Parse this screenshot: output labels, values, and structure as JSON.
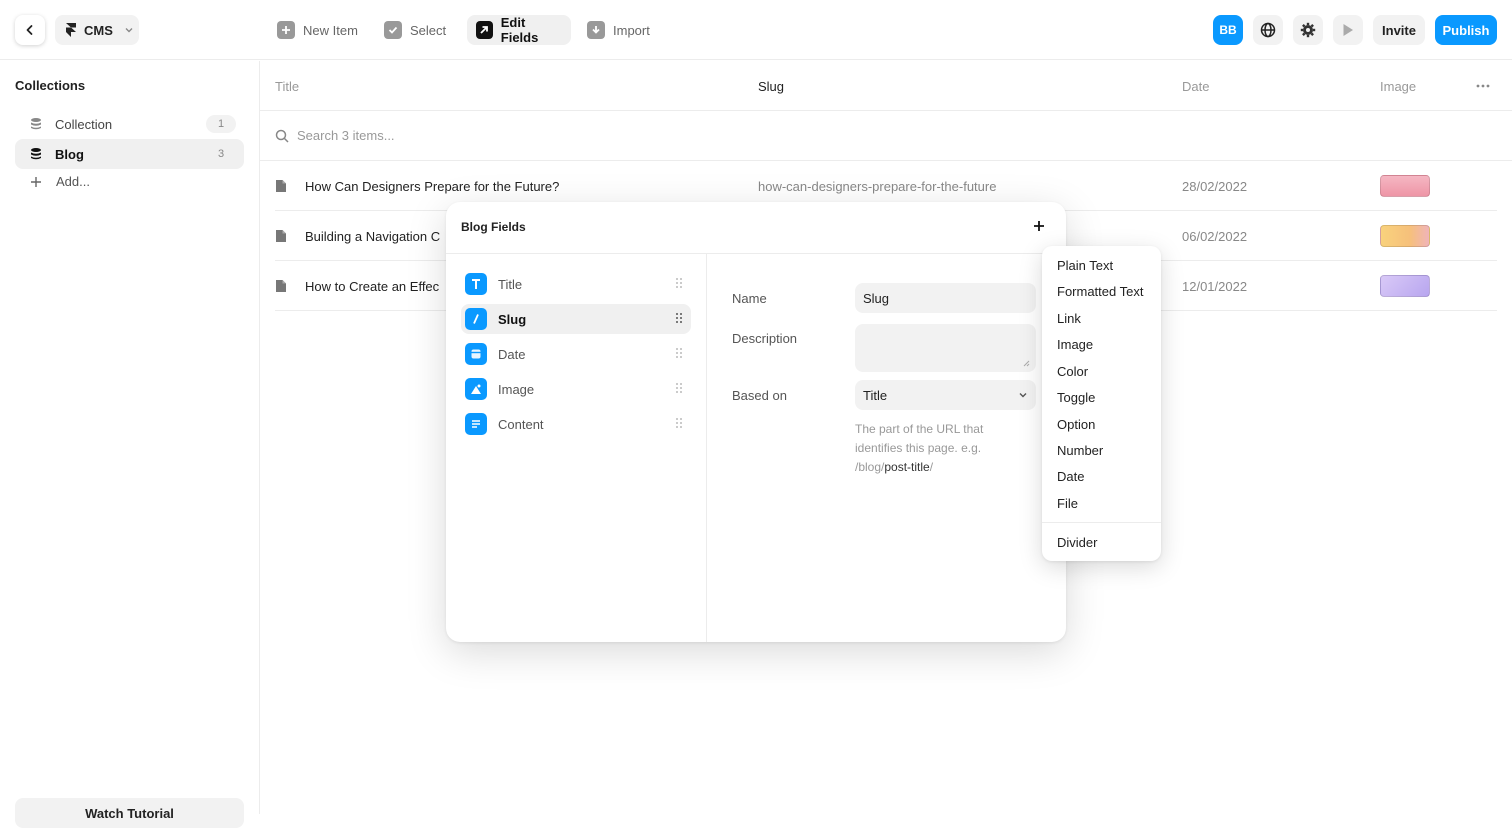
{
  "topbar": {
    "cms_label": "CMS",
    "tools": {
      "new_item": "New Item",
      "select": "Select",
      "edit_fields": "Edit Fields",
      "import": "Import"
    },
    "avatar_initials": "BB",
    "invite_label": "Invite",
    "publish_label": "Publish"
  },
  "sidebar": {
    "title": "Collections",
    "items": [
      {
        "label": "Collection",
        "count": "1"
      },
      {
        "label": "Blog",
        "count": "3"
      }
    ],
    "add_label": "Add...",
    "watch_label": "Watch Tutorial"
  },
  "table": {
    "columns": {
      "title": "Title",
      "slug": "Slug",
      "date": "Date",
      "image": "Image"
    },
    "search_placeholder": "Search 3 items...",
    "rows": [
      {
        "title": "How Can Designers Prepare for the Future?",
        "slug": "how-can-designers-prepare-for-the-future",
        "date": "28/02/2022"
      },
      {
        "title": "Building a Navigation C",
        "slug": "",
        "date": "06/02/2022"
      },
      {
        "title": "How to Create an Effec",
        "slug": "",
        "date": "12/01/2022"
      }
    ]
  },
  "modal": {
    "title": "Blog Fields",
    "fields": [
      {
        "label": "Title",
        "icon": "text-t-icon"
      },
      {
        "label": "Slug",
        "icon": "slash-icon"
      },
      {
        "label": "Date",
        "icon": "calendar-icon"
      },
      {
        "label": "Image",
        "icon": "image-icon"
      },
      {
        "label": "Content",
        "icon": "lines-icon"
      }
    ],
    "form": {
      "name_label": "Name",
      "name_value": "Slug",
      "description_label": "Description",
      "description_value": "",
      "based_on_label": "Based on",
      "based_on_value": "Title",
      "hint_prefix": "The part of the URL that identifies this page. e.g. /blog/",
      "hint_bold": "post-title",
      "hint_suffix": "/"
    }
  },
  "dropdown": {
    "items": [
      "Plain Text",
      "Formatted Text",
      "Link",
      "Image",
      "Color",
      "Toggle",
      "Option",
      "Number",
      "Date",
      "File"
    ],
    "divider_item": "Divider"
  },
  "colors": {
    "accent": "#0a99ff",
    "thumb1": "#f2a6b4",
    "thumb2": "#f7c97a",
    "thumb3": "#c9b9f3"
  }
}
